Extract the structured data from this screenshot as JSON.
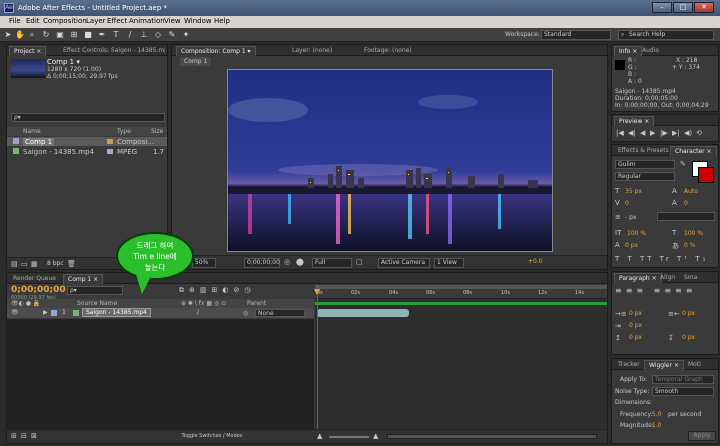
{
  "window": {
    "title": "Adobe After Effects - Untitled Project.aep *",
    "app_icon": "Ae",
    "controls": [
      "–",
      "□",
      "✕"
    ]
  },
  "menu": [
    "File",
    "Edit",
    "Composition",
    "Layer",
    "Effect",
    "Animation",
    "View",
    "Window",
    "Help"
  ],
  "toolbar": {
    "workspace_label": "Workspace:",
    "workspace_value": "Standard",
    "search_placeholder": "Search Help"
  },
  "project": {
    "tabs": [
      "Project ×",
      "Effect Controls: Saigon - 14385.mp4"
    ],
    "comp_name": "Comp 1 ▾",
    "info_lines": [
      "1280 x 720 (1.00)",
      "Δ 0;00;15;00, 29.97 fps"
    ],
    "search_placeholder": "ρ▾",
    "columns": [
      "Name",
      "Type",
      "Size"
    ],
    "items": [
      {
        "name": "Comp 1",
        "type": "Composi...",
        "size": ""
      },
      {
        "name": "Saigon - 14385.mp4",
        "type": "MPEG",
        "size": "1.7"
      }
    ],
    "bpc": "8 bpc"
  },
  "viewer": {
    "tabs": [
      "Composition: Comp 1 ▾",
      "Layer: (none)",
      "Footage: (none)"
    ],
    "subtab": "Comp 1",
    "controls": {
      "zoom": "50%",
      "timecode": "0;00;00;00",
      "resolution": "Full",
      "camera": "Active Camera",
      "views": "1 View",
      "plus": "+0.0"
    }
  },
  "right": {
    "info_tabs": [
      "Info ×",
      "Audio"
    ],
    "info_rgba": [
      "R :",
      "G :",
      "B :",
      "A : 0"
    ],
    "info_xy": [
      "X : 218",
      "+ Y : 374"
    ],
    "info_lines": [
      "Saigon - 14385.mp4",
      "Duration: 0;00;05;00",
      "In: 0;00;00;00, Out: 0;00;04;29"
    ],
    "preview_tab": "Preview ×",
    "preview_buttons": [
      "|◀",
      "◀|",
      "◀",
      "▶",
      "|▶",
      "▶|",
      "◀)",
      "⟲"
    ],
    "effects_tabs": [
      "Effects & Presets",
      "Character ×"
    ],
    "char_font": "Gulim",
    "char_style": "Regular",
    "char_values": {
      "size": "35 px",
      "leading": "Auto",
      "kerning": "0",
      "tracking": "0",
      "stroke": "- px",
      "vscale": "100 %",
      "hscale": "100 %",
      "baseline": "0 px",
      "tsume": "0 %"
    },
    "para_tabs": [
      "Paragraph ×",
      "Align",
      "Sma"
    ],
    "para_values": [
      "0 px",
      "0 px",
      "0 px",
      "0 px",
      "0 px"
    ],
    "wiggler_tabs": [
      "Tracker",
      "Wiggler ×",
      "Moti"
    ],
    "wiggler": {
      "apply_to_label": "Apply To:",
      "apply_to": "Temporal Graph",
      "noise_label": "Noise Type:",
      "noise": "Smooth",
      "dimensions_label": "Dimensions:",
      "dimensions": "",
      "freq_label": "Frequency:",
      "freq": "5.0",
      "freq_unit": "per second",
      "mag_label": "Magnitude:",
      "mag": "1.0",
      "apply_button": "Apply"
    }
  },
  "timeline": {
    "tabs": [
      "Render Queue",
      "Comp 1 ×"
    ],
    "timecode": "0;00;00;00",
    "fps_info": "00000 (29.97 fps)",
    "search_placeholder": "ρ▾",
    "col_source": "Source Name",
    "col_parent": "Parent",
    "layer_index": "1",
    "layer_name": "Saigon - 14385.mp4",
    "parent_value": "None",
    "ruler": [
      "0s",
      "02s",
      "04s",
      "06s",
      "08s",
      "10s",
      "12s",
      "14s"
    ],
    "toggle_label": "Toggle Switches / Modes"
  },
  "annotation": {
    "line1": "드래그 하여",
    "line2": "Tim e line에",
    "line3": "놓는다"
  }
}
